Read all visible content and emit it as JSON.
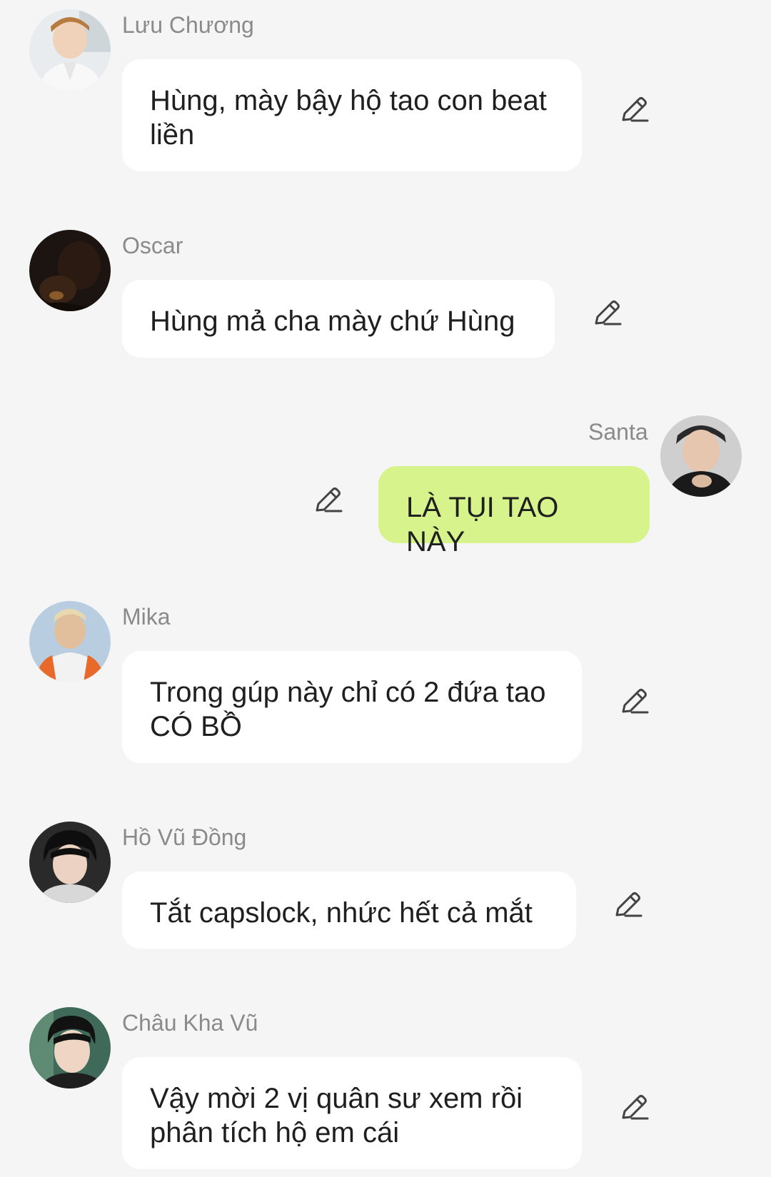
{
  "conversation": {
    "messages": [
      {
        "sender": "Lưu Chương",
        "text": "Hùng, mày bậy hộ tao con beat liền",
        "outgoing": false
      },
      {
        "sender": "Oscar",
        "text": "Hùng mả cha mày chứ Hùng",
        "outgoing": false
      },
      {
        "sender": "Santa",
        "text": "LÀ TỤI TAO NÀY",
        "outgoing": true
      },
      {
        "sender": "Mika",
        "text": "Trong gúp này chỉ có 2 đứa tao CÓ BỒ",
        "outgoing": false
      },
      {
        "sender": "Hồ Vũ Đồng",
        "text": "Tắt capslock, nhức hết cả mắt",
        "outgoing": false
      },
      {
        "sender": "Châu Kha Vũ",
        "text": "Vậy mời 2 vị quân sư xem rồi phân tích hộ em cái",
        "outgoing": false
      }
    ]
  },
  "colors": {
    "background": "#f5f5f5",
    "incoming_bubble": "#ffffff",
    "outgoing_bubble": "#d6f38c",
    "sender_name": "#8a8a8a",
    "message_text": "#1f1f1f",
    "edit_icon": "#444444"
  },
  "icons": {
    "edit": "pencil-edit-icon",
    "avatar": "user-avatar-photo"
  }
}
